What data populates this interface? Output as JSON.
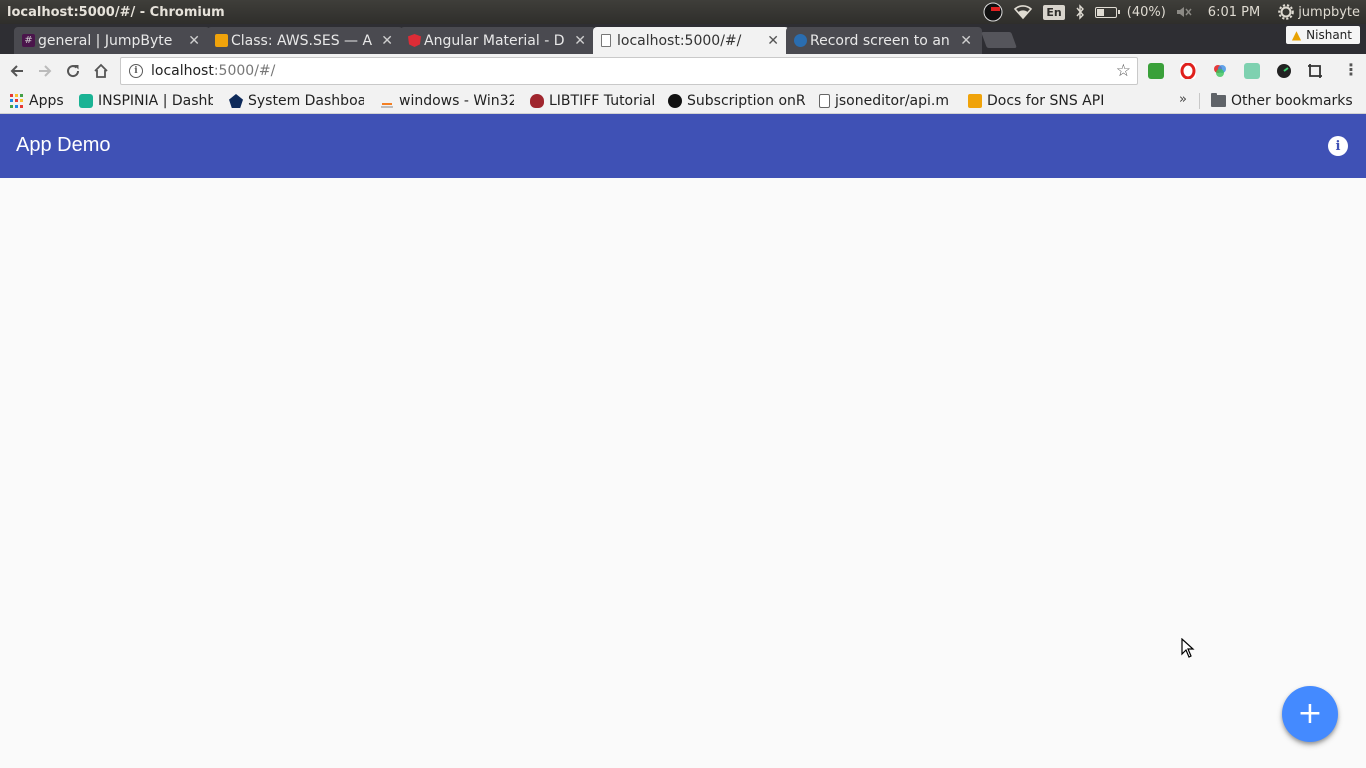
{
  "os": {
    "window_title": "localhost:5000/#/ - Chromium",
    "lang": "En",
    "battery": "(40%)",
    "time": "6:01 PM",
    "user": "jumpbyte"
  },
  "browser": {
    "tabs": [
      {
        "title": "general | JumpByte",
        "favicon_color": "#4a154b"
      },
      {
        "title": "Class: AWS.SES — A",
        "favicon_color": "#f0a30a"
      },
      {
        "title": "Angular Material - D",
        "favicon_color": "#dd2c36"
      },
      {
        "title": "localhost:5000/#/",
        "favicon_color": "#ffffff",
        "active": true
      },
      {
        "title": "Record screen to an",
        "favicon_color": "#2a6db0"
      }
    ],
    "profile_name": "Nishant",
    "url_host": "localhost",
    "url_rest": ":5000/#/",
    "bookmarks": [
      {
        "label": "Apps",
        "icon": "apps-grid-icon"
      },
      {
        "label": "INSPINIA | Dashb",
        "icon": "inspinia-icon"
      },
      {
        "label": "System Dashboar",
        "icon": "dashboard-icon"
      },
      {
        "label": "windows - Win32",
        "icon": "stackoverflow-icon"
      },
      {
        "label": "LIBTIFF Tutorial",
        "icon": "libtiff-icon"
      },
      {
        "label": "Subscription onR",
        "icon": "github-icon"
      },
      {
        "label": "jsoneditor/api.m",
        "icon": "file-icon"
      },
      {
        "label": "Docs for SNS API",
        "icon": "aws-icon"
      }
    ],
    "other_bookmarks": "Other bookmarks",
    "bookmarks_overflow": "»"
  },
  "app": {
    "title": "App Demo",
    "info_icon": "i",
    "fab_icon": "+",
    "colors": {
      "primary": "#3f51b5",
      "accent": "#448aff"
    }
  }
}
